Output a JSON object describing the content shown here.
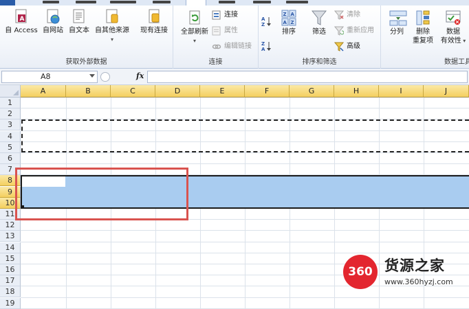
{
  "ribbon": {
    "groups": {
      "external": {
        "label": "获取外部数据",
        "access": "自 Access",
        "web": "自网站",
        "text": "自文本",
        "other": "自其他来源",
        "existing": "现有连接"
      },
      "connections": {
        "label": "连接",
        "refresh": "全部刷新",
        "connect": "连接",
        "props": "属性",
        "edit_links": "编辑链接"
      },
      "sort_filter": {
        "label": "排序和筛选",
        "sort": "排序",
        "filter": "筛选",
        "clear": "清除",
        "reapply": "重新应用",
        "advanced": "高级"
      },
      "data_tools": {
        "label": "数据工具",
        "split": "分列",
        "remove_dup_1": "删除",
        "remove_dup_2": "重复项",
        "validation_1": "数据",
        "validation_2": "有效性"
      }
    }
  },
  "formula_bar": {
    "name_box": "A8",
    "fx": "fx"
  },
  "grid": {
    "columns": [
      "A",
      "B",
      "C",
      "D",
      "E",
      "F",
      "G",
      "H",
      "I",
      "J"
    ],
    "rows": [
      "1",
      "2",
      "3",
      "4",
      "5",
      "6",
      "7",
      "8",
      "9",
      "10",
      "11",
      "12",
      "13",
      "14",
      "15",
      "16",
      "17",
      "18",
      "19"
    ],
    "selected_rows": [
      "8",
      "9",
      "10"
    ]
  },
  "watermark": {
    "logo_number": "360",
    "name": "货源之家",
    "url": "www.360hyzj.com"
  },
  "colors": {
    "selection": "#a9ccf0",
    "header_highlight": "#f4cf5f",
    "annotation": "#d9534f",
    "watermark_red": "#e3262f"
  }
}
